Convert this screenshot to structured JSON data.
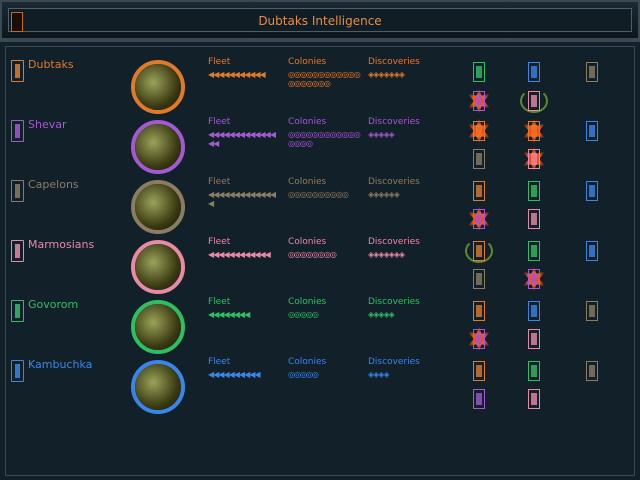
{
  "window": {
    "title": "Dubtaks Intelligence"
  },
  "labels": {
    "fleet": "Fleet",
    "colonies": "Colonies",
    "discoveries": "Discoveries"
  },
  "races": [
    {
      "name": "Dubtaks",
      "color": "#e07a2a",
      "fleet": "◀◀◀◀◀◀◀◀◀◀◀",
      "colonies": "◎◎◎◎◎◎◎◎◎◎◎◎◎◎◎◎◎◎◎",
      "discoveries": "◈◈◈◈◈◈◈",
      "relations": [
        {
          "race": "Govorom",
          "status": "peace"
        },
        {
          "race": "Kambuchka",
          "status": "peace"
        },
        {
          "race": "Capelons",
          "status": "peace"
        },
        {
          "race": "Shevar",
          "status": "war"
        },
        {
          "race": "Marmosians",
          "status": "alliance"
        }
      ]
    },
    {
      "name": "Shevar",
      "color": "#a35ad0",
      "fleet": "◀◀◀◀◀◀◀◀◀◀◀◀◀◀◀",
      "colonies": "◎◎◎◎◎◎◎◎◎◎◎◎◎◎◎◎",
      "discoveries": "◈◈◈◈◈",
      "relations": [
        {
          "race": "Dubtaks",
          "status": "war"
        },
        {
          "race": "Dubtaks",
          "status": "war"
        },
        {
          "race": "Kambuchka",
          "status": "peace"
        },
        {
          "race": "Capelons",
          "status": "peace"
        },
        {
          "race": "Marmosians",
          "status": "war"
        }
      ]
    },
    {
      "name": "Capelons",
      "color": "#8c7c62",
      "fleet": "◀◀◀◀◀◀◀◀◀◀◀◀◀◀",
      "colonies": "◎◎◎◎◎◎◎◎◎◎",
      "discoveries": "◈◈◈◈◈◈",
      "relations": [
        {
          "race": "Dubtaks",
          "status": "peace"
        },
        {
          "race": "Govorom",
          "status": "peace"
        },
        {
          "race": "Kambuchka",
          "status": "peace"
        },
        {
          "race": "Shevar",
          "status": "war"
        },
        {
          "race": "Marmosians",
          "status": "peace"
        }
      ]
    },
    {
      "name": "Marmosians",
      "color": "#e88aa5",
      "fleet": "◀◀◀◀◀◀◀◀◀◀◀◀",
      "colonies": "◎◎◎◎◎◎◎◎",
      "discoveries": "◈◈◈◈◈◈◈",
      "relations": [
        {
          "race": "Dubtaks",
          "status": "alliance"
        },
        {
          "race": "Govorom",
          "status": "peace"
        },
        {
          "race": "Kambuchka",
          "status": "peace"
        },
        {
          "race": "Capelons",
          "status": "peace"
        },
        {
          "race": "Shevar",
          "status": "war"
        }
      ]
    },
    {
      "name": "Govorom",
      "color": "#2fbf63",
      "fleet": "◀◀◀◀◀◀◀◀",
      "colonies": "◎◎◎◎◎",
      "discoveries": "◈◈◈◈◈",
      "relations": [
        {
          "race": "Dubtaks",
          "status": "peace"
        },
        {
          "race": "Kambuchka",
          "status": "peace"
        },
        {
          "race": "Capelons",
          "status": "peace"
        },
        {
          "race": "Shevar",
          "status": "war"
        },
        {
          "race": "Marmosians",
          "status": "peace"
        }
      ]
    },
    {
      "name": "Kambuchka",
      "color": "#3a86e8",
      "fleet": "◀◀◀◀◀◀◀◀◀◀",
      "colonies": "◎◎◎◎◎",
      "discoveries": "◈◈◈◈",
      "relations": [
        {
          "race": "Dubtaks",
          "status": "peace"
        },
        {
          "race": "Govorom",
          "status": "peace"
        },
        {
          "race": "Capelons",
          "status": "peace"
        },
        {
          "race": "Shevar",
          "status": "peace"
        },
        {
          "race": "Marmosians",
          "status": "peace"
        }
      ]
    }
  ]
}
